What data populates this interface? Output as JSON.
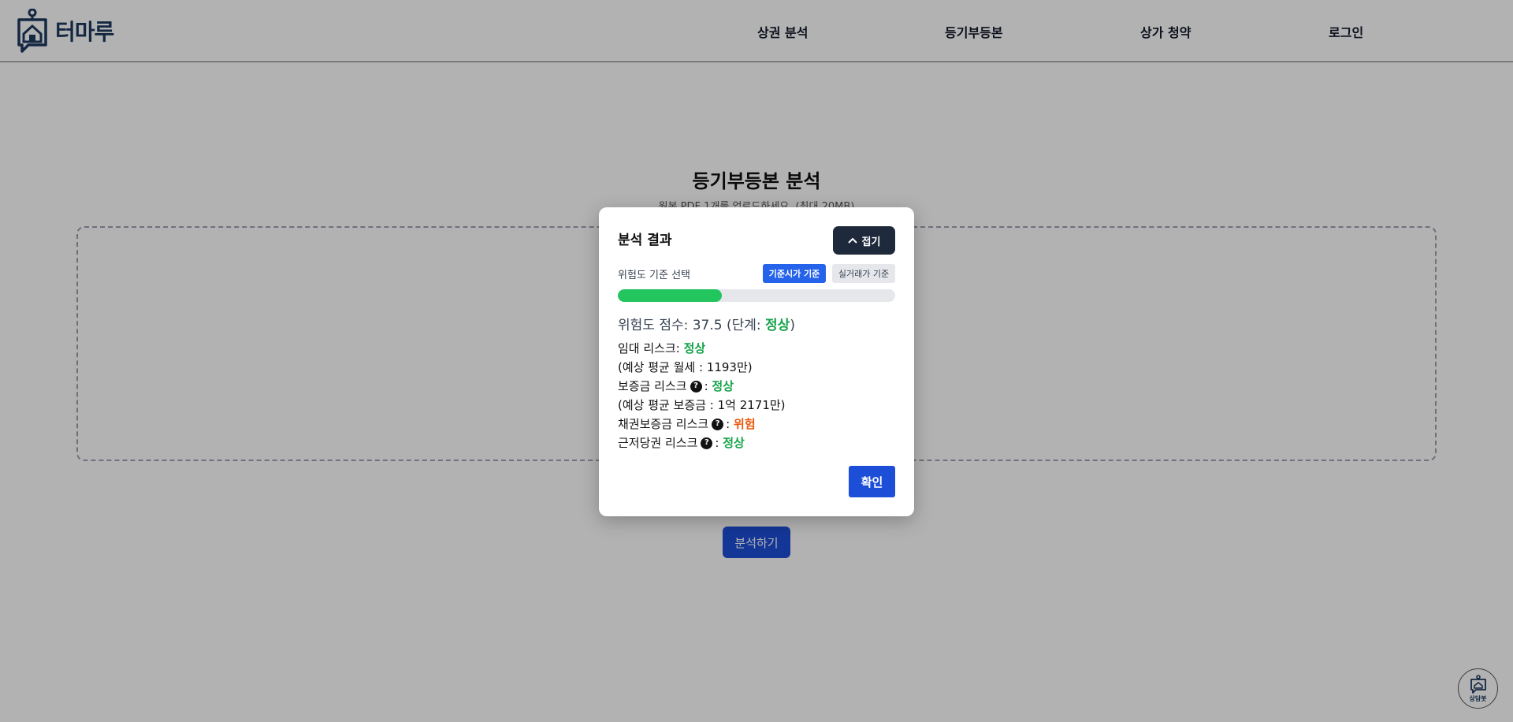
{
  "header": {
    "logo_text": "터마루",
    "nav": [
      "상권 분석",
      "등기부등본",
      "상가 청약",
      "로그인"
    ]
  },
  "page": {
    "title": "등기부등본 분석",
    "subtitle": "원본 PDF 1개를 업로드하세요. (최대 20MB)",
    "analyze_button": "분석하기"
  },
  "chatbot": {
    "label": "상담봇",
    "icon": "chatbot-icon"
  },
  "modal": {
    "title": "분석 결과",
    "collapse_button": "접기",
    "standard_label": "위험도 기준 선택",
    "standard_options": [
      "기준시가 기준",
      "실거래가 기준"
    ],
    "selected_standard": "기준시가 기준",
    "score_percent": 37.5,
    "score_prefix": "위험도 점수: 37.5 (단계: ",
    "score_level": "정상",
    "score_suffix": ")",
    "rent_risk_label": "임대 리스크:",
    "rent_risk_value": "정상",
    "rent_note": "(예상 평균 월세 : 1193만)",
    "deposit_risk_label": "보증금 리스크",
    "deposit_risk_value": "정상",
    "deposit_note": "(예상 평균 보증금 : 1억 2171만)",
    "bond_risk_label": "채권보증금 리스크",
    "bond_risk_value": "위험",
    "mortgage_risk_label": "근저당권 리스크",
    "mortgage_risk_value": "정상",
    "colon": ":",
    "help_glyph": "?",
    "confirm_button": "확인"
  },
  "colors": {
    "primary": "#2563eb",
    "dark_button": "#1e293b",
    "progress_fill": "#22c55e",
    "safe": "#16a34a",
    "danger": "#ea580c"
  }
}
